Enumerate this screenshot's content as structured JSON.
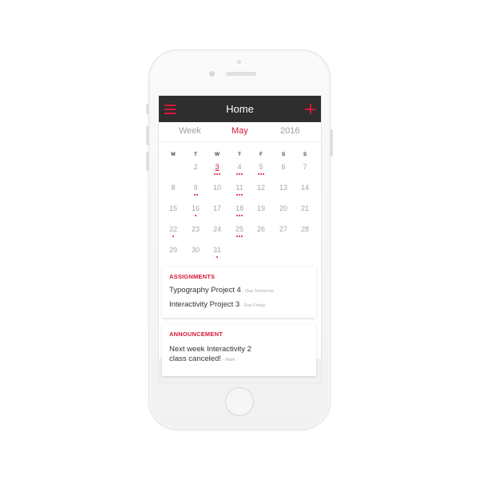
{
  "navbar": {
    "title": "Home"
  },
  "calendar": {
    "view_label": "Week",
    "month": "May",
    "year": "2016",
    "weekdays": [
      "M",
      "T",
      "W",
      "T",
      "F",
      "S",
      "S"
    ],
    "days": [
      {
        "label": "2",
        "dots": 0
      },
      {
        "label": "3",
        "dots": 3,
        "today": true
      },
      {
        "label": "4",
        "dots": 3
      },
      {
        "label": "5",
        "dots": 3
      },
      {
        "label": "6",
        "dots": 0
      },
      {
        "label": "7",
        "dots": 0
      },
      {
        "label": "8",
        "dots": 0
      },
      {
        "label": "9",
        "dots": 2
      },
      {
        "label": "10",
        "dots": 0
      },
      {
        "label": "11",
        "dots": 3
      },
      {
        "label": "12",
        "dots": 0
      },
      {
        "label": "13",
        "dots": 0
      },
      {
        "label": "14",
        "dots": 0
      },
      {
        "label": "15",
        "dots": 0
      },
      {
        "label": "16",
        "dots": 1
      },
      {
        "label": "17",
        "dots": 0
      },
      {
        "label": "18",
        "dots": 3
      },
      {
        "label": "19",
        "dots": 0
      },
      {
        "label": "20",
        "dots": 0
      },
      {
        "label": "21",
        "dots": 0
      },
      {
        "label": "22",
        "dots": 1
      },
      {
        "label": "23",
        "dots": 0
      },
      {
        "label": "24",
        "dots": 0
      },
      {
        "label": "25",
        "dots": 3
      },
      {
        "label": "26",
        "dots": 0
      },
      {
        "label": "27",
        "dots": 0
      },
      {
        "label": "28",
        "dots": 0
      },
      {
        "label": "29",
        "dots": 0
      },
      {
        "label": "30",
        "dots": 0
      },
      {
        "label": "31",
        "dots": 1
      }
    ]
  },
  "assignments": {
    "title": "ASSIGNMENTS",
    "items": [
      {
        "name": "Typography Project 4",
        "meta": "- Due Tomorrow"
      },
      {
        "name": "Interactivity Project 3",
        "meta": "- Due Friday"
      }
    ]
  },
  "announcement": {
    "title": "ANNOUNCEMENT",
    "line1": "Next week Interactivity 2",
    "line2": "class canceled!",
    "author": "- Mark"
  },
  "colors": {
    "accent": "#d7173a",
    "navbar": "#2e2e2e",
    "muted": "#a6a6a6"
  }
}
